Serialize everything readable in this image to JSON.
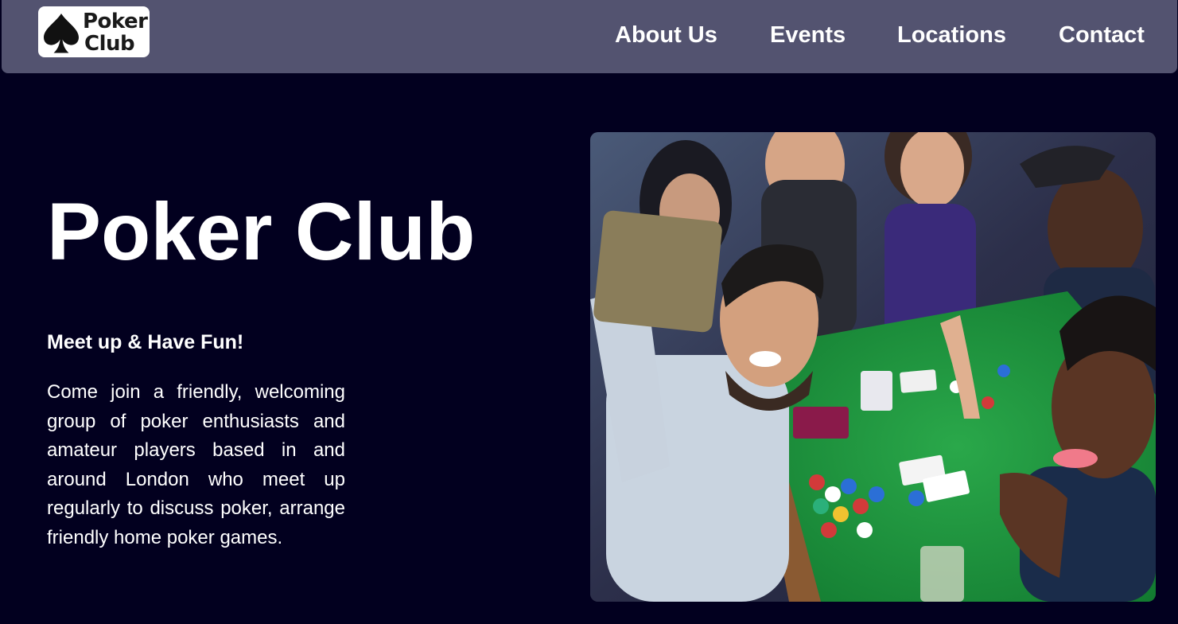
{
  "header": {
    "logo": {
      "line1": "Poker",
      "line2": "Club",
      "icon": "spade-icon"
    },
    "nav": [
      {
        "label": "About Us"
      },
      {
        "label": "Events"
      },
      {
        "label": "Locations"
      },
      {
        "label": "Contact"
      }
    ]
  },
  "hero": {
    "title": "Poker Club",
    "tagline": "Meet up & Have Fun!",
    "description": "Come join a friendly, welcoming group of poker enthusiasts and amateur players based in and around London who meet up regularly to discuss poker, arrange friendly home poker games.",
    "image": "photo of friends taking a selfie around a green poker table with chips and cards"
  },
  "colors": {
    "background": "#02001f",
    "navbar": "#535370",
    "text": "#ffffff",
    "table_felt": "#1f8a3a"
  }
}
